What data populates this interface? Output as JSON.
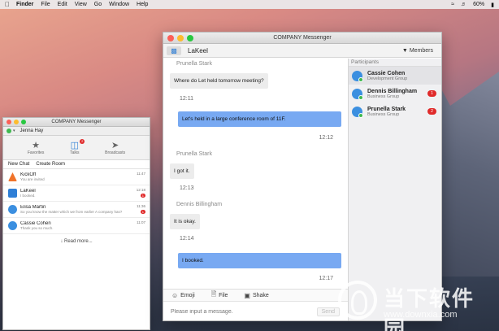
{
  "menubar": {
    "app": "Finder",
    "items": [
      "File",
      "Edit",
      "View",
      "Go",
      "Window",
      "Help"
    ],
    "battery": "60%"
  },
  "watermark": {
    "title": "当下软件园",
    "url": "www.downxia.com"
  },
  "small_window": {
    "title": "COMPANY Messenger",
    "user": "Jenna Hay",
    "tabs": [
      {
        "label": "Favorites",
        "icon": "star-icon"
      },
      {
        "label": "Talks",
        "icon": "chat-icon",
        "badge": "2"
      },
      {
        "label": "Broadcasts",
        "icon": "megaphone-icon"
      }
    ],
    "actions": {
      "new_chat": "New Chat",
      "create_room": "Create Room"
    },
    "chats": [
      {
        "name": "KickOff",
        "preview": "You are invited",
        "time": "11:47",
        "badge": ""
      },
      {
        "name": "LaKeel",
        "preview": "I booked.",
        "time": "12:18",
        "badge": "1"
      },
      {
        "name": "Elisa Martin",
        "preview": "So you know the matter which we from earlier A company has?",
        "time": "11:36",
        "badge": "1"
      },
      {
        "name": "Cassie Cohen",
        "preview": "Thank you so much.",
        "time": "11:07",
        "badge": ""
      }
    ],
    "read_more": "Read more..."
  },
  "main_window": {
    "title": "COMPANY Messenger",
    "room": "LaKeel",
    "members_label": "Members",
    "messages": [
      {
        "sender": "Prunella Stark",
        "text": "Where do Let held tomorrow meeting?",
        "time": "12:11",
        "dir": "in"
      },
      {
        "sender": "",
        "text": "Let's held in a large conference room of 11F.",
        "time": "12:12",
        "dir": "out"
      },
      {
        "sender": "Prunella Stark",
        "text": "I got it.",
        "time": "12:13",
        "dir": "in"
      },
      {
        "sender": "Dennis Billingham",
        "text": "It is okay.",
        "time": "12:14",
        "dir": "in"
      },
      {
        "sender": "",
        "text": "I booked.",
        "time": "12:17",
        "dir": "out"
      }
    ],
    "toolbar": {
      "emoji": "Emoji",
      "file": "File",
      "shake": "Shake"
    },
    "input_placeholder": "Please input a message.",
    "send_label": "Send",
    "participants_header": "Participants",
    "participants": [
      {
        "name": "Cassie Cohen",
        "group": "Development Group",
        "badge": ""
      },
      {
        "name": "Dennis Billingham",
        "group": "Business Group",
        "badge": "1"
      },
      {
        "name": "Prunella Stark",
        "group": "Business Group",
        "badge": "2"
      }
    ]
  }
}
